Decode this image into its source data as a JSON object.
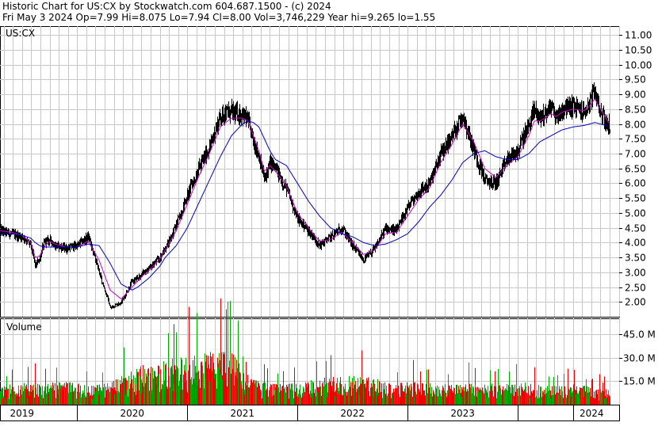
{
  "header": {
    "line1": "Historic Chart for US:CX by Stockwatch.com 604.687.1500 - (c) 2024",
    "line2": "Fri May  3 2024   Op=7.99  Hi=8.075  Lo=7.94  Cl=8.00  Vol=3,746,229  Year hi=9.265  lo=1.55"
  },
  "chart_data": [
    {
      "type": "line",
      "title": "US:CX",
      "ylim": [
        1.5,
        11.3
      ],
      "y_ticks": [
        "11.00",
        "10.50",
        "10.00",
        "9.50",
        "9.00",
        "8.50",
        "8.00",
        "7.50",
        "7.00",
        "6.50",
        "6.00",
        "5.50",
        "5.00",
        "4.50",
        "4.00",
        "3.50",
        "3.00",
        "2.50",
        "2.00"
      ],
      "y_tick_values": [
        11.0,
        10.5,
        10.0,
        9.5,
        9.0,
        8.5,
        8.0,
        7.5,
        7.0,
        6.5,
        6.0,
        5.5,
        5.0,
        4.5,
        4.0,
        3.5,
        3.0,
        2.5,
        2.0
      ],
      "grid": true,
      "x_range": [
        2018.8,
        2024.42
      ],
      "x": [
        2018.8,
        2018.9,
        2019.0,
        2019.08,
        2019.12,
        2019.16,
        2019.2,
        2019.25,
        2019.3,
        2019.4,
        2019.5,
        2019.6,
        2019.7,
        2019.8,
        2019.9,
        2020.0,
        2020.05,
        2020.1,
        2020.15,
        2020.2,
        2020.25,
        2020.3,
        2020.4,
        2020.5,
        2020.6,
        2020.7,
        2020.8,
        2020.9,
        2021.0,
        2021.05,
        2021.1,
        2021.15,
        2021.2,
        2021.25,
        2021.3,
        2021.4,
        2021.5,
        2021.6,
        2021.7,
        2021.8,
        2021.9,
        2022.0,
        2022.1,
        2022.2,
        2022.3,
        2022.4,
        2022.5,
        2022.6,
        2022.7,
        2022.8,
        2022.9,
        2023.0,
        2023.1,
        2023.2,
        2023.3,
        2023.4,
        2023.5,
        2023.6,
        2023.65,
        2023.7,
        2023.75,
        2023.8,
        2023.85,
        2023.9,
        2024.0,
        2024.1,
        2024.15,
        2024.2,
        2024.25,
        2024.3,
        2024.33
      ],
      "series": [
        {
          "color": "#000000",
          "values": [
            4.4,
            4.3,
            4.2,
            3.9,
            3.2,
            3.5,
            4.0,
            4.1,
            3.9,
            3.8,
            3.9,
            4.2,
            3.0,
            1.8,
            2.0,
            2.7,
            2.8,
            3.0,
            3.1,
            3.3,
            3.5,
            3.8,
            4.6,
            5.6,
            6.5,
            7.2,
            8.3,
            8.4,
            8.3,
            8.1,
            7.4,
            6.9,
            6.1,
            6.7,
            6.5,
            5.8,
            4.8,
            4.4,
            3.9,
            4.2,
            4.5,
            3.9,
            3.4,
            3.8,
            4.5,
            4.4,
            5.2,
            5.7,
            6.0,
            7.0,
            7.6,
            8.3,
            7.1,
            6.1,
            6.0,
            6.8,
            7.1,
            8.0,
            8.5,
            8.2,
            8.4,
            8.6,
            8.2,
            8.5,
            8.6,
            8.4,
            8.7,
            9.1,
            8.4,
            8.0,
            7.9
          ]
        },
        {
          "color": "#cc00cc",
          "values": [
            4.4,
            4.35,
            4.25,
            4.0,
            3.5,
            3.55,
            3.85,
            4.05,
            3.95,
            3.85,
            3.85,
            4.05,
            3.4,
            2.4,
            2.1,
            2.5,
            2.7,
            2.9,
            3.05,
            3.25,
            3.45,
            3.75,
            4.4,
            5.3,
            6.2,
            7.0,
            7.9,
            8.2,
            8.2,
            8.1,
            7.6,
            7.1,
            6.4,
            6.6,
            6.4,
            5.9,
            5.0,
            4.5,
            4.05,
            4.1,
            4.35,
            4.0,
            3.6,
            3.75,
            4.3,
            4.35,
            4.9,
            5.45,
            5.85,
            6.7,
            7.3,
            8.0,
            7.4,
            6.5,
            6.2,
            6.6,
            6.9,
            7.6,
            8.1,
            8.1,
            8.2,
            8.35,
            8.25,
            8.4,
            8.5,
            8.45,
            8.6,
            8.85,
            8.5,
            8.2,
            8.0
          ]
        },
        {
          "color": "#0000cc",
          "values": [
            4.3,
            4.3,
            4.25,
            4.15,
            4.0,
            3.9,
            3.85,
            3.85,
            3.85,
            3.85,
            3.85,
            3.95,
            3.9,
            3.3,
            2.6,
            2.4,
            2.5,
            2.65,
            2.8,
            3.0,
            3.2,
            3.5,
            3.9,
            4.5,
            5.3,
            6.1,
            6.9,
            7.6,
            8.0,
            8.1,
            8.05,
            7.9,
            7.5,
            7.1,
            6.8,
            6.6,
            6.0,
            5.4,
            4.9,
            4.5,
            4.3,
            4.2,
            4.0,
            3.9,
            3.95,
            4.1,
            4.3,
            4.7,
            5.2,
            5.6,
            6.1,
            6.7,
            7.0,
            7.1,
            6.9,
            6.8,
            6.8,
            7.0,
            7.2,
            7.4,
            7.5,
            7.6,
            7.7,
            7.8,
            7.9,
            7.95,
            8.0,
            8.05,
            8.0,
            7.95,
            7.9
          ]
        }
      ]
    },
    {
      "type": "bar",
      "title": "Volume",
      "ylim": [
        0,
        55
      ],
      "y_ticks": [
        "45.0 M",
        "30.0 M",
        "15.0 M"
      ],
      "y_tick_values": [
        45,
        30,
        15
      ],
      "grid": true,
      "x_range": [
        2018.8,
        2024.42
      ],
      "volume_x": [
        2018.8,
        2019.0,
        2019.2,
        2019.4,
        2019.6,
        2019.8,
        2020.0,
        2020.1,
        2020.2,
        2020.3,
        2020.5,
        2020.7,
        2020.9,
        2021.0,
        2021.1,
        2021.2,
        2021.4,
        2021.6,
        2021.8,
        2022.0,
        2022.2,
        2022.4,
        2022.6,
        2022.8,
        2023.0,
        2023.2,
        2023.4,
        2023.6,
        2023.8,
        2024.0,
        2024.2,
        2024.33
      ],
      "volume_values": [
        10,
        12,
        11,
        13,
        10,
        12,
        18,
        22,
        20,
        24,
        26,
        28,
        30,
        18,
        14,
        12,
        11,
        13,
        15,
        16,
        14,
        12,
        12,
        11,
        11,
        12,
        11,
        12,
        10,
        11,
        9,
        8
      ],
      "colors": {
        "up": "#00aa00",
        "down": "#ee0000"
      }
    }
  ],
  "x_axis": {
    "labels": [
      "2019",
      "2020",
      "2021",
      "2022",
      "2023",
      "2024"
    ],
    "label_x": [
      2019.0,
      2020.0,
      2021.0,
      2022.0,
      2023.0,
      2024.17
    ],
    "boundaries": [
      2019.5,
      2020.5,
      2021.5,
      2022.5,
      2023.5,
      2024.0
    ]
  }
}
